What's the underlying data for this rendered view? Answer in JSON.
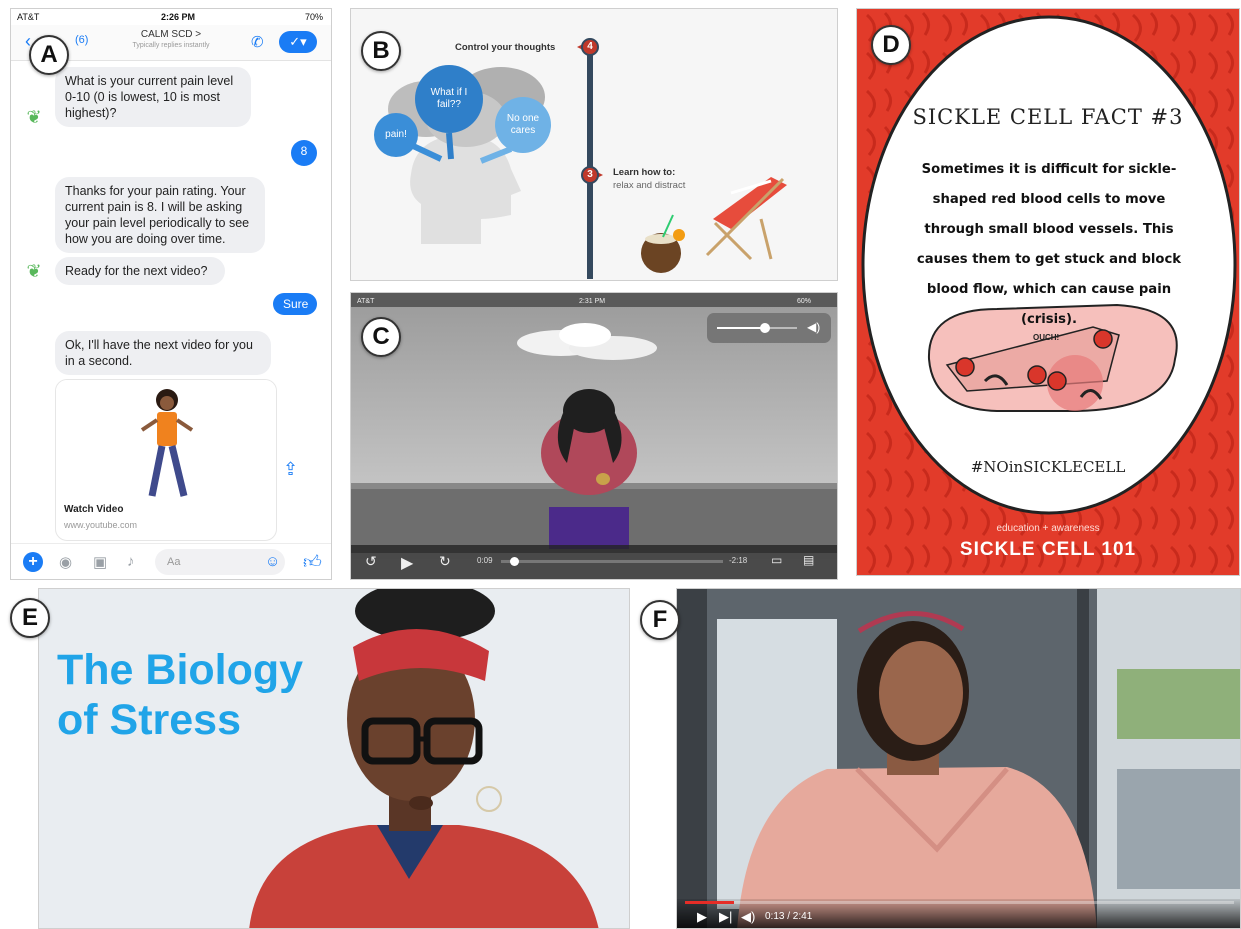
{
  "labels": {
    "a": "A",
    "b": "B",
    "c": "C",
    "d": "D",
    "e": "E",
    "f": "F"
  },
  "panel_a": {
    "status": {
      "carrier": "AT&T",
      "time": "2:26 PM",
      "battery": "70%"
    },
    "header": {
      "unread_count": "(6)",
      "title": "CALM SCD >",
      "subtitle": "Typically replies instantly"
    },
    "messages": {
      "q_pain": "What is your current pain level 0-10 (0 is lowest, 10 is most highest)?",
      "reply_8": "8",
      "thanks": "Thanks for your pain rating. Your current pain is 8. I will be asking your pain level periodically to see how you are doing over time.",
      "ready": "Ready for the next video?",
      "reply_sure": "Sure",
      "ok": "Ok, I'll have the next video for you in a second."
    },
    "video_card": {
      "caption": "Watch Video",
      "url": "www.youtube.com"
    },
    "composer": {
      "placeholder": "Aa"
    }
  },
  "panel_b": {
    "step4": {
      "number": "4",
      "label": "Control your thoughts"
    },
    "step3": {
      "number": "3",
      "label": "Learn how to:",
      "sublabel": "relax and distract"
    },
    "bubbles": {
      "b1": "pain!",
      "b2": "What if I fail??",
      "b3": "No one cares"
    }
  },
  "panel_c": {
    "status": {
      "carrier": "AT&T",
      "time": "2:31 PM",
      "battery": "60%"
    },
    "player": {
      "elapsed": "0:09",
      "remaining": "-2:18",
      "progress": 0.06,
      "volume": 0.6
    }
  },
  "panel_d": {
    "title": "SICKLE CELL FACT #3",
    "body": "Sometimes it is difficult for sickle-shaped red blood cells to move through small blood vessels. This causes them to get stuck and block blood flow, which can cause pain (crisis).",
    "ouch": "OUCH!",
    "hashtag": "#NOinSICKLECELL",
    "tagline": "education + awareness",
    "brand": "SICKLE CELL 101"
  },
  "panel_e": {
    "title_line1": "The Biology",
    "title_line2": "of Stress"
  },
  "panel_f": {
    "time": "0:13 / 2:41",
    "progress": 0.09
  },
  "colors": {
    "messenger_blue": "#1a7cf5",
    "fact_red": "#e23b2a",
    "stress_blue": "#20a4e8"
  }
}
